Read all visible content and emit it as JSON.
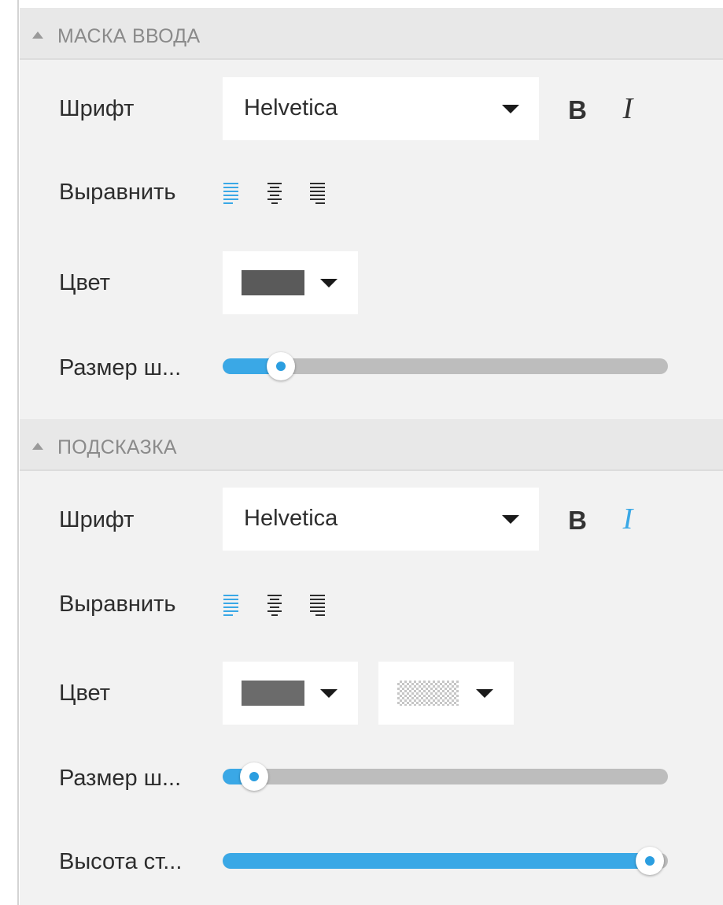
{
  "colors": {
    "accent": "#3aa8e6",
    "panel_bg": "#f2f2f2",
    "header_bg": "#e8e8e8",
    "text_color_1": "#5a5a5a",
    "text_color_2": "#6b6b6b"
  },
  "sections": [
    {
      "title": "МАСКА ВВОДА",
      "font_label": "Шрифт",
      "font_value": "Helvetica",
      "bold_label": "B",
      "italic_label": "I",
      "bold_active": false,
      "italic_active": false,
      "align_label": "Выравнить",
      "align_selected": "left",
      "color_label": "Цвет",
      "size_label": "Размер ш...",
      "size_value": 0.13
    },
    {
      "title": "ПОДСКАЗКА",
      "font_label": "Шрифт",
      "font_value": "Helvetica",
      "bold_label": "B",
      "italic_label": "I",
      "bold_active": false,
      "italic_active": true,
      "align_label": "Выравнить",
      "align_selected": "left",
      "color_label": "Цвет",
      "background_color": "transparent",
      "size_label": "Размер ш...",
      "size_value": 0.07,
      "line_height_label": "Высота ст...",
      "line_height_value": 0.96
    }
  ]
}
